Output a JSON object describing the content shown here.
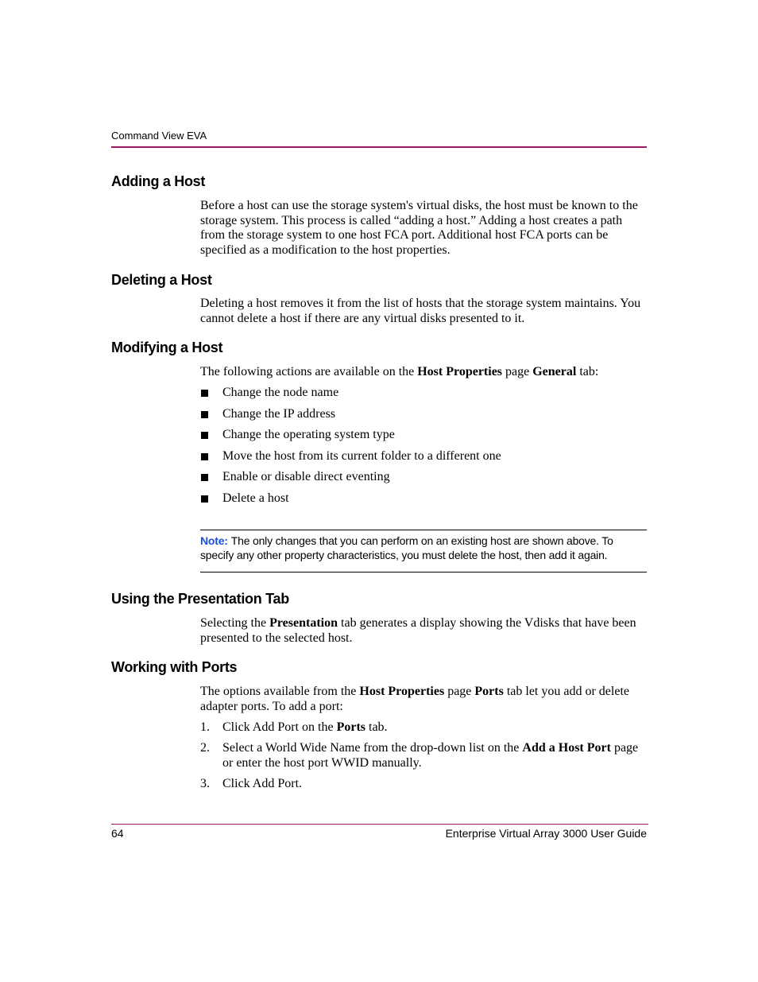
{
  "header": {
    "running_head": "Command View EVA"
  },
  "sections": {
    "adding": {
      "title": "Adding a Host",
      "body": "Before a host can use the storage system's virtual disks, the host must be known to the storage system. This process is called “adding a host.” Adding a host creates a path from the storage system to one host FCA port. Additional host FCA ports can be specified as a modification to the host properties."
    },
    "deleting": {
      "title": "Deleting a Host",
      "body": "Deleting a host removes it from the list of hosts that the storage system maintains. You cannot delete a host if there are any virtual disks presented to it."
    },
    "modifying": {
      "title": "Modifying a Host",
      "intro_pre": "The following actions are available on the ",
      "intro_bold1": "Host Properties",
      "intro_mid": " page ",
      "intro_bold2": "General",
      "intro_post": " tab:",
      "items": [
        "Change the node name",
        "Change the IP address",
        "Change the operating system type",
        "Move the host from its current folder to a different one",
        "Enable or disable direct eventing",
        "Delete a host"
      ],
      "note_label": "Note:",
      "note_text": "The only changes that you can perform on an existing host are shown above. To specify any other property characteristics, you must delete the host, then add it again."
    },
    "presentation": {
      "title": "Using the Presentation Tab",
      "body_pre": "Selecting the ",
      "body_bold": "Presentation",
      "body_post": " tab generates a display showing the Vdisks that have been presented to the selected host."
    },
    "ports": {
      "title": "Working with Ports",
      "intro_pre": "The options available from the ",
      "intro_bold1": "Host Properties",
      "intro_mid": " page ",
      "intro_bold2": "Ports",
      "intro_post": " tab let you add or delete adapter ports. To add a port:",
      "steps": [
        {
          "num": "1.",
          "pre": "Click Add Port on the ",
          "bold": "Ports",
          "post": " tab."
        },
        {
          "num": "2.",
          "pre": "Select a World Wide Name from the drop-down list on the ",
          "bold": "Add a Host Port",
          "post": " page or enter the host port WWID manually."
        },
        {
          "num": "3.",
          "pre": "Click Add Port.",
          "bold": "",
          "post": ""
        }
      ]
    }
  },
  "footer": {
    "page_number": "64",
    "guide_title": "Enterprise Virtual Array 3000 User Guide"
  },
  "colors": {
    "rule": "#9b1760",
    "note_label": "#1a4fd6"
  }
}
